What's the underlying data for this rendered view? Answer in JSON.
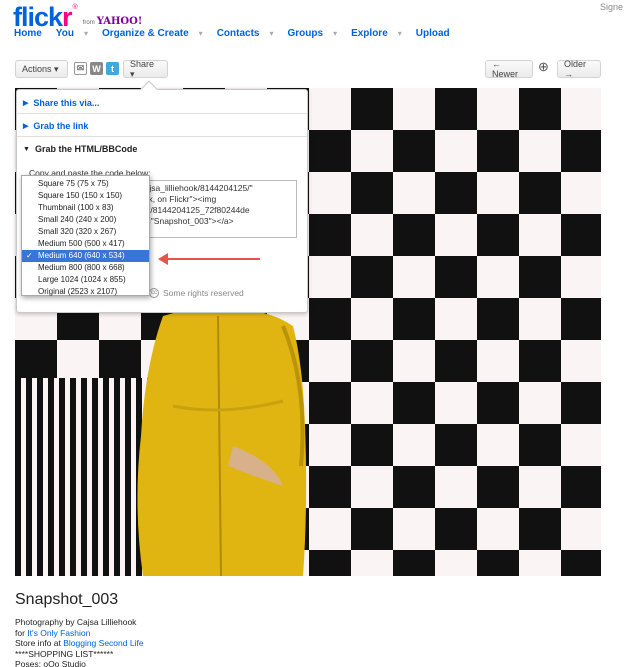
{
  "header": {
    "logo_text_blue": "flick",
    "logo_text_pink": "r",
    "logo_reg": "®",
    "logo_from": "from",
    "logo_yahoo": "YAHOO!",
    "signin": "Signe"
  },
  "nav": {
    "items": [
      {
        "label": "Home",
        "caret": ""
      },
      {
        "label": "You",
        "caret": "▾"
      },
      {
        "label": "Organize & Create",
        "caret": "▾"
      },
      {
        "label": "Contacts",
        "caret": "▾"
      },
      {
        "label": "Groups",
        "caret": "▾"
      },
      {
        "label": "Explore",
        "caret": "▾"
      },
      {
        "label": "Upload",
        "caret": ""
      }
    ]
  },
  "toolbar": {
    "actions_label": "Actions ▾",
    "share_label": "Share ▾",
    "newer_label": "← Newer",
    "older_label": "Older →",
    "zoom_icon": "⊕"
  },
  "share_popup": {
    "section_share_via": "Share this via...",
    "section_grab_link": "Grab the link",
    "section_grab_html": "Grab the HTML/BBCode",
    "copy_label": "Copy and paste the code below:",
    "code_lines": [
      "otos/cajsa_lilliehook/8144204125/\"",
      "illiehook, on Flickr\"><img",
      "m/8468/8144204125_72f80244de",
      "34\" alt=\"Snapshot_003\"></a>"
    ],
    "rights_label": "Some rights reserved"
  },
  "size_dropdown": {
    "options": [
      "Square 75 (75 x 75)",
      "Square 150 (150 x 150)",
      "Thumbnail (100 x 83)",
      "Small 240 (240 x 200)",
      "Small 320 (320 x 267)",
      "Medium 500 (500 x 417)",
      "Medium 640 (640 x 534)",
      "Medium 800 (800 x 668)",
      "Large 1024 (1024 x 855)",
      "Original (2523 x 2107)"
    ],
    "selected_index": 6,
    "check": "✓"
  },
  "photo": {
    "title": "Snapshot_003",
    "meta_line1": "Photography by Cajsa Lilliehook",
    "meta_for": "for ",
    "meta_for_link": "It's Only Fashion",
    "meta_store": "Store info at ",
    "meta_store_link": "Blogging Second Life",
    "meta_line4": "****SHOPPING LIST******",
    "meta_line5": "Poses: oOo Studio"
  },
  "colors": {
    "flickr_blue": "#0063dc",
    "flickr_pink": "#ff0084",
    "selected_option": "#3875d7",
    "annotation_arrow": "#e8534b"
  }
}
